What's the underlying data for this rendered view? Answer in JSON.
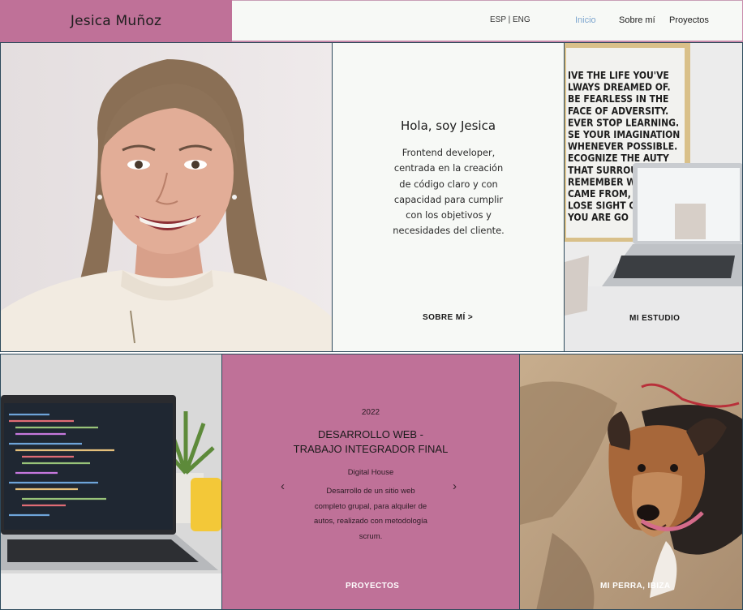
{
  "header": {
    "brand": "Jesica Muñoz",
    "lang_switch": "ESP | ENG",
    "nav": [
      "Inicio",
      "Sobre mí",
      "Proyectos"
    ]
  },
  "intro": {
    "title": "Hola, soy Jesica",
    "text": "Frontend developer, centrada en la creación de código claro y con capacidad para cumplir con los objetivos y necesidades del cliente.",
    "link": "SOBRE MÍ  >"
  },
  "studio": {
    "link": "MI ESTUDIO",
    "poster_lines": [
      "IVE THE LIFE YOU'VE",
      "LWAYS DREAMED OF.",
      "BE FEARLESS IN THE",
      "FACE OF ADVERSITY.",
      "EVER STOP LEARNING.",
      "SE YOUR IMAGINATION",
      "WHENEVER POSSIBLE.",
      "ECOGNIZE THE    AUTY",
      "THAT SURROUND",
      "REMEMBER WH",
      "CAME FROM, BU",
      "LOSE SIGHT OF",
      "YOU ARE GO"
    ]
  },
  "project": {
    "year": "2022",
    "title_line1": "DESARROLLO WEB -",
    "title_line2": "TRABAJO INTEGRADOR FINAL",
    "org": "Digital House",
    "description": "Desarrollo de un sitio web completo grupal, para alquiler de autos, realizado con metodología scrum.",
    "link": "PROYECTOS",
    "prev_icon": "‹",
    "next_icon": "›"
  },
  "dog": {
    "caption": "MI PERRA, IBIZA"
  },
  "colors": {
    "accent_pink": "#bf7198",
    "nav_active": "#7fa7cf",
    "tile_border": "#2d4a5c",
    "panel_bg": "#f7f9f6"
  }
}
